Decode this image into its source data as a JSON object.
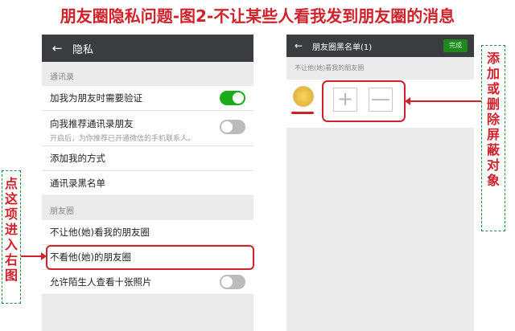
{
  "title": "朋友圈隐私问题-图2-不让某些人看我发到朋友圈的消息",
  "left_screen": {
    "back_icon": "←",
    "header_title": "隐私",
    "section_contacts": "通讯录",
    "items": [
      {
        "label": "加我为朋友时需要验证",
        "toggle": "on"
      },
      {
        "label": "向我推荐通讯录朋友",
        "sub": "开启后，为你推荐已开通微信的手机联系人。",
        "toggle": "off"
      },
      {
        "label": "添加我的方式"
      },
      {
        "label": "通讯录黑名单"
      }
    ],
    "section_moments": "朋友圈",
    "moments_items": [
      {
        "label": "不让他(她)看我的朋友圈"
      },
      {
        "label": "不看他(她)的朋友圈"
      },
      {
        "label": "允许陌生人查看十张照片",
        "toggle": "off"
      }
    ]
  },
  "right_screen": {
    "back_icon": "←",
    "header_title": "朋友圈黑名单(1)",
    "done_label": "完成",
    "section_label": "不让他(她)看我的朋友圈",
    "plus_icon": "+",
    "minus_icon": "—"
  },
  "left_note": [
    "点",
    "这",
    "项",
    "进",
    "入",
    "右",
    "图"
  ],
  "right_note": [
    "添",
    "加",
    "或",
    "删",
    "除",
    "屏",
    "蔽",
    "对",
    "象"
  ],
  "colors": {
    "accent_red": "#d0222a",
    "toggle_green": "#1aad19",
    "header_dark": "#3a3c3f"
  }
}
